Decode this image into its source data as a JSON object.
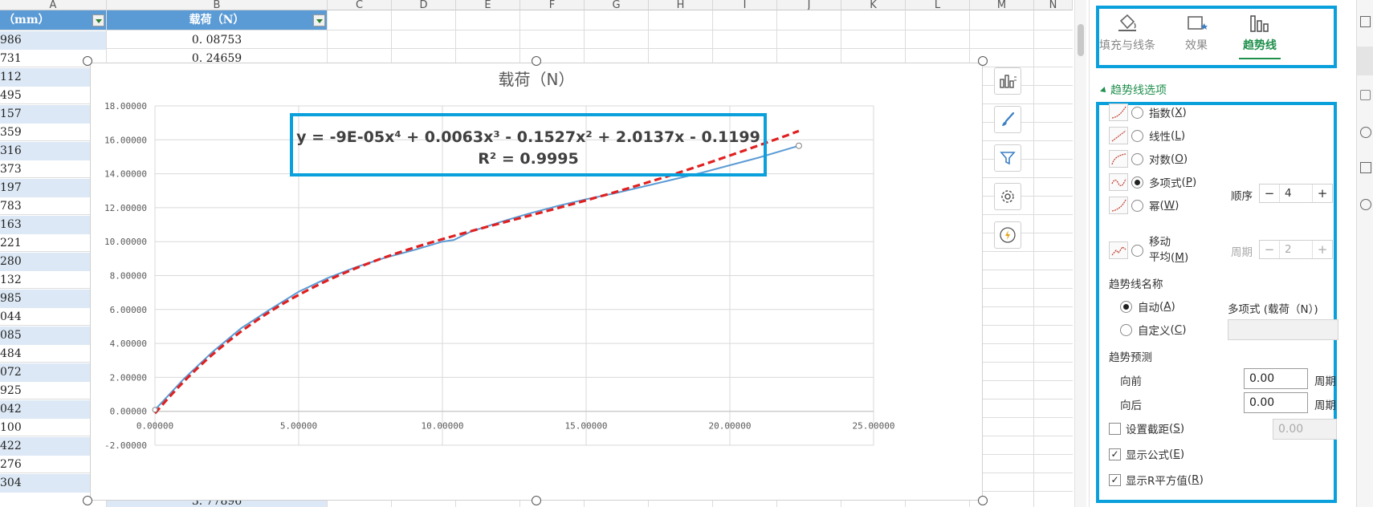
{
  "sheet": {
    "columns": [
      "A",
      "B",
      "C",
      "D",
      "E",
      "F",
      "G",
      "H",
      "I",
      "J",
      "K",
      "L",
      "M",
      "N"
    ],
    "header_a": "（mm）",
    "header_b": "载荷（N）",
    "col_a_values": [
      "986",
      "731",
      "112",
      "495",
      "157",
      "359",
      "316",
      "373",
      "197",
      "783",
      "163",
      "221",
      "280",
      "132",
      "985",
      "044",
      "085",
      "484",
      "072",
      "925",
      "042",
      "100",
      "422",
      "276",
      "304"
    ],
    "col_b_first": "0. 08753",
    "col_b_second": "0. 24659",
    "col_b_last": "3. 77896"
  },
  "chart_data": {
    "type": "scatter",
    "title": "载荷（N）",
    "xlim": [
      0,
      25
    ],
    "ylim": [
      -2,
      18
    ],
    "x_ticks": [
      "0.00000",
      "5.00000",
      "10.00000",
      "15.00000",
      "20.00000",
      "25.00000"
    ],
    "y_ticks": [
      "-2.00000",
      "0.00000",
      "2.00000",
      "4.00000",
      "6.00000",
      "8.00000",
      "10.00000",
      "12.00000",
      "14.00000",
      "16.00000",
      "18.00000"
    ],
    "series": [
      {
        "kind": "data-line",
        "color": "#5b9bd5",
        "x": [
          0,
          1,
          2,
          3,
          4,
          5,
          6,
          7,
          8,
          9,
          10,
          10.4,
          11,
          12,
          13,
          14,
          15,
          16,
          17,
          18,
          19,
          20,
          21,
          22,
          22.4
        ],
        "y": [
          0.09,
          1.9,
          3.5,
          4.9,
          6.0,
          7.05,
          7.85,
          8.5,
          9.05,
          9.5,
          10.0,
          10.1,
          10.6,
          11.15,
          11.65,
          12.1,
          12.5,
          12.85,
          13.25,
          13.65,
          14.05,
          14.5,
          14.95,
          15.45,
          15.65
        ]
      },
      {
        "kind": "polynomial-trendline",
        "color": "#e02020",
        "coefficients": [
          -0.1199,
          2.0137,
          -0.1527,
          0.0063,
          -9e-05
        ],
        "x_range": [
          0,
          22.4
        ]
      }
    ],
    "equation": "y = -9E-05x⁴ + 0.0063x³ - 0.1527x² + 2.0137x - 0.1199",
    "r_squared": "R² = 0.9995",
    "grid": true,
    "legend": "none"
  },
  "chart_buttons": [
    "chart-elements-icon",
    "chart-style-brush-icon",
    "chart-filter-icon",
    "chart-settings-gear-icon",
    "chart-idea-bulb-icon"
  ],
  "panel": {
    "tabs": [
      {
        "label": "填充与线条",
        "icon": "fill-bucket-icon"
      },
      {
        "label": "效果",
        "icon": "effects-icon"
      },
      {
        "label": "趋势线",
        "icon": "trendline-bars-icon"
      }
    ],
    "section_title": "趋势线选项",
    "types": [
      {
        "label": "指数",
        "key": "X",
        "selected": false
      },
      {
        "label": "线性",
        "key": "L",
        "selected": false
      },
      {
        "label": "对数",
        "key": "O",
        "selected": false
      },
      {
        "label": "多项式",
        "key": "P",
        "selected": true
      },
      {
        "label": "幂",
        "key": "W",
        "selected": false
      }
    ],
    "moving_avg_line1": "移动",
    "moving_avg_line2": "平均",
    "moving_avg_key": "M",
    "order_label": "顺序",
    "order_value": "4",
    "period_label": "周期",
    "period_value": "2",
    "name_section": "趋势线名称",
    "auto_label": "自动",
    "auto_key": "A",
    "auto_value": "多项式 (载荷（N）)",
    "custom_label": "自定义",
    "custom_key": "C",
    "forecast_section": "趋势预测",
    "forward_label": "向前",
    "forward_value": "0.00",
    "backward_label": "向后",
    "backward_value": "0.00",
    "period_unit": "周期",
    "intercept_label": "设置截距",
    "intercept_key": "S",
    "intercept_value": "0.00",
    "show_equation_label": "显示公式",
    "show_equation_key": "E",
    "show_r2_label": "显示R平方值",
    "show_r2_key": "R",
    "minus": "−",
    "plus": "+",
    "check": "✓"
  }
}
